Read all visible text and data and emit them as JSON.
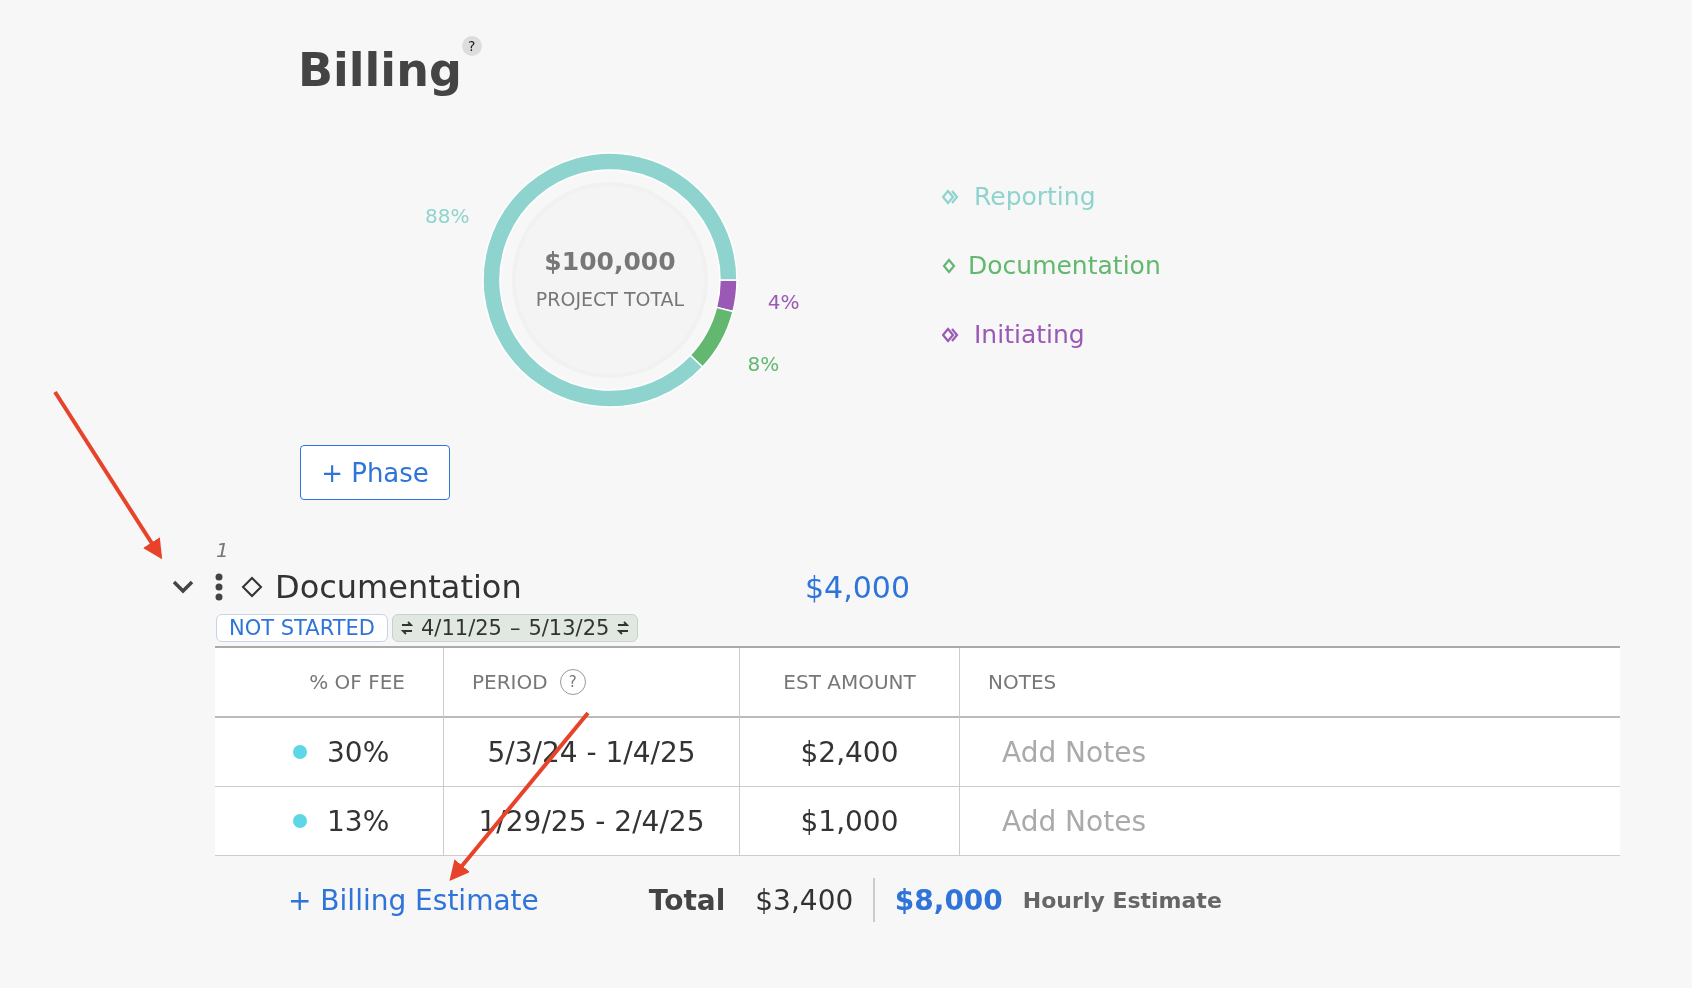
{
  "page": {
    "title": "Billing",
    "help": "?"
  },
  "chart": {
    "center_value": "$100,000",
    "center_label": "PROJECT TOTAL",
    "chart_data": {
      "type": "donut",
      "categories": [
        "Reporting",
        "Documentation",
        "Initiating"
      ],
      "series": [
        {
          "values": [
            88,
            8,
            4
          ]
        }
      ],
      "value_labels": [
        "88%",
        "8%",
        "4%"
      ]
    }
  },
  "legend": [
    {
      "color": "#8fd3cf",
      "kind": "group"
    },
    {
      "color": "#63b86f",
      "kind": "single"
    },
    {
      "color": "#9b59b6",
      "kind": "group"
    }
  ],
  "add_phase_button": "+ Phase",
  "phase": {
    "number": "1",
    "expanded": true,
    "name": "Documentation",
    "amount": "$4,000",
    "status": "NOT STARTED",
    "start": "4/11/25",
    "separator": "–",
    "end": "5/13/25"
  },
  "table": {
    "columns": [
      {
        "label": "% OF FEE"
      },
      {
        "label": "PERIOD",
        "help": "?"
      },
      {
        "label": "EST AMOUNT"
      },
      {
        "label": "NOTES"
      }
    ],
    "rows": [
      {
        "fee": "30%",
        "period": "5/3/24 - 1/4/25",
        "amount": "$2,400",
        "notes_placeholder": "Add Notes"
      },
      {
        "fee": "13%",
        "period": "1/29/25 - 2/4/25",
        "amount": "$1,000",
        "notes_placeholder": "Add Notes"
      }
    ]
  },
  "footer": {
    "add_button": "+ Billing Estimate",
    "total_label": "Total",
    "total": "$3,400",
    "hourly_amount": "$8,000",
    "hourly_label": "Hourly Estimate"
  }
}
